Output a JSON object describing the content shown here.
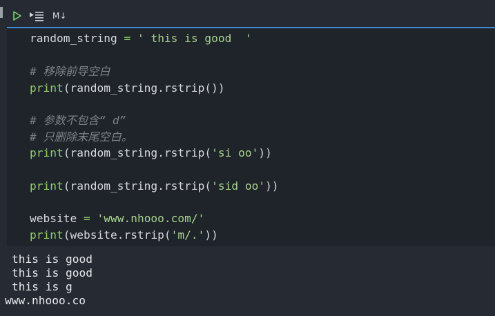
{
  "toolbar": {
    "run_icon": "play-icon",
    "run_below_icon": "run-below-icon",
    "markdown_label": "M↓"
  },
  "colors": {
    "accent": "#3d8ad6",
    "keyword": "#8fd16a",
    "string": "#a8d58c",
    "comment": "#7c8189",
    "text": "#d7dadf"
  },
  "code": {
    "l1": {
      "a": "random_string ",
      "b": "=",
      "c": " ",
      "d": "' this is good  '"
    },
    "l3": {
      "a": "# 移除前导空白"
    },
    "l4": {
      "a": "print",
      "b": "(random_string.rstrip())"
    },
    "l6": {
      "a": "# 参数不包含“ d”"
    },
    "l7": {
      "a": "# 只删除末尾空白。"
    },
    "l8": {
      "a": "print",
      "b": "(random_string.rstrip(",
      "c": "'si oo'",
      "d": "))"
    },
    "l10": {
      "a": "print",
      "b": "(random_string.rstrip(",
      "c": "'sid oo'",
      "d": "))"
    },
    "l12": {
      "a": "website ",
      "b": "=",
      "c": " ",
      "d": "'www.nhooo.com/'"
    },
    "l13": {
      "a": "print",
      "b": "(website.rstrip(",
      "c": "'m/.'",
      "d": "))"
    }
  },
  "output": {
    "lines": [
      "this is good",
      "this is good",
      "this is g",
      "www.nhooo.co"
    ]
  }
}
